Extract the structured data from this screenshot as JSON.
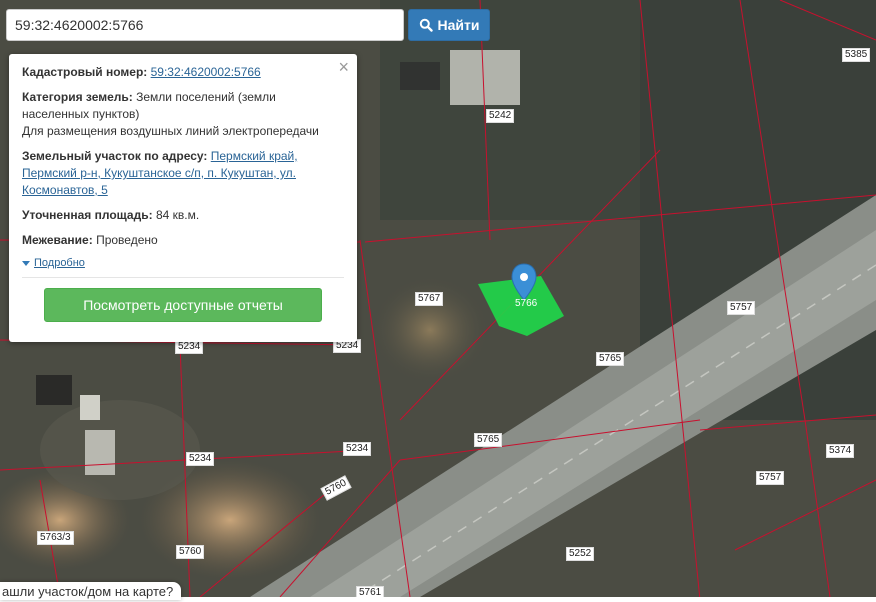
{
  "search": {
    "value": "59:32:4620002:5766"
  },
  "find_button": {
    "label": "Найти",
    "icon": "search-icon"
  },
  "popup": {
    "cadastral": {
      "label": "Кадастровый номер:",
      "value": "59:32:4620002:5766"
    },
    "category": {
      "label": "Категория земель:",
      "value": "Земли поселений (земли населенных пунктов)",
      "usage": "Для размещения воздушных линий электропередачи"
    },
    "address": {
      "label": "Земельный участок по адресу:",
      "value": "Пермский край, Пермский р-н, Кукуштанское с/п, п. Кукуштан, ул. Космонавтов, 5"
    },
    "area": {
      "label": "Уточненная площадь:",
      "value": "84 кв.м."
    },
    "survey": {
      "label": "Межевание:",
      "value": "Проведено"
    },
    "more_label": "Подробно",
    "reports_button": "Посмотреть доступные отчеты",
    "close": "×"
  },
  "parcels": [
    "5385",
    "5242",
    "5767",
    "5766",
    "5757",
    "5765",
    "5234",
    "5234",
    "5234",
    "5234",
    "5765",
    "5374",
    "5760",
    "5757",
    "5763/3",
    "5760",
    "5252",
    "5761"
  ],
  "bottom_tip": "ашли участок/дом на карте?",
  "colors": {
    "boundary": "#c8102e",
    "selected_parcel": "#1fd84a",
    "marker": "#3b8fd6",
    "button_blue": "#337ab7",
    "button_green": "#5cb85c"
  }
}
